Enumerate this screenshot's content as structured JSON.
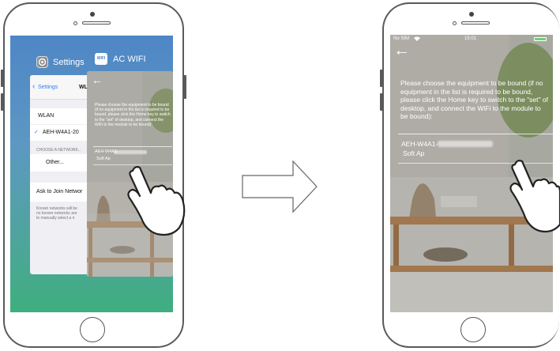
{
  "left_phone": {
    "switcher": {
      "settings_app_label": "Settings",
      "ac_app_label": "AC WIFI",
      "ac_app_icon_text": "WIFI"
    },
    "settings_card": {
      "back_label": "Settings",
      "title_partial": "WL",
      "wlan_label": "WLAN",
      "connected_network": "AEH-W4A1-20",
      "choose_network_header": "CHOOSE A NETWORK...",
      "other_label": "Other...",
      "ask_to_join_label": "Ask to Join Networ",
      "ask_to_join_note": "Known networks will be\nno known networks are\nto manually select a n"
    },
    "ac_card": {
      "instruction": "Please choose the equipment to be bound (if no equipment in the list is required to be bound, please click the Home key to switch to the \"set\" of desktop, and connect the WiFi to the module to be bound):",
      "device_name": "AEH-W4A1-",
      "device_type": "Soft Ap"
    }
  },
  "right_phone": {
    "status_bar": {
      "carrier": "No SIM",
      "time": "15:01"
    },
    "instruction": "Please choose the equipment to be bound (if no equipment in the list is required to be bound, please click the Home key to switch to the \"set\" of desktop, and connect the WiFi to the module to be bound):",
    "device_name": "AEH-W4A1-",
    "device_type": "Soft Ap"
  },
  "colors": {
    "frame": "#5a5a5a",
    "switcher_top": "#4f86c6",
    "switcher_bottom": "#3fae7f",
    "ios_blue": "#2f7cf6"
  }
}
